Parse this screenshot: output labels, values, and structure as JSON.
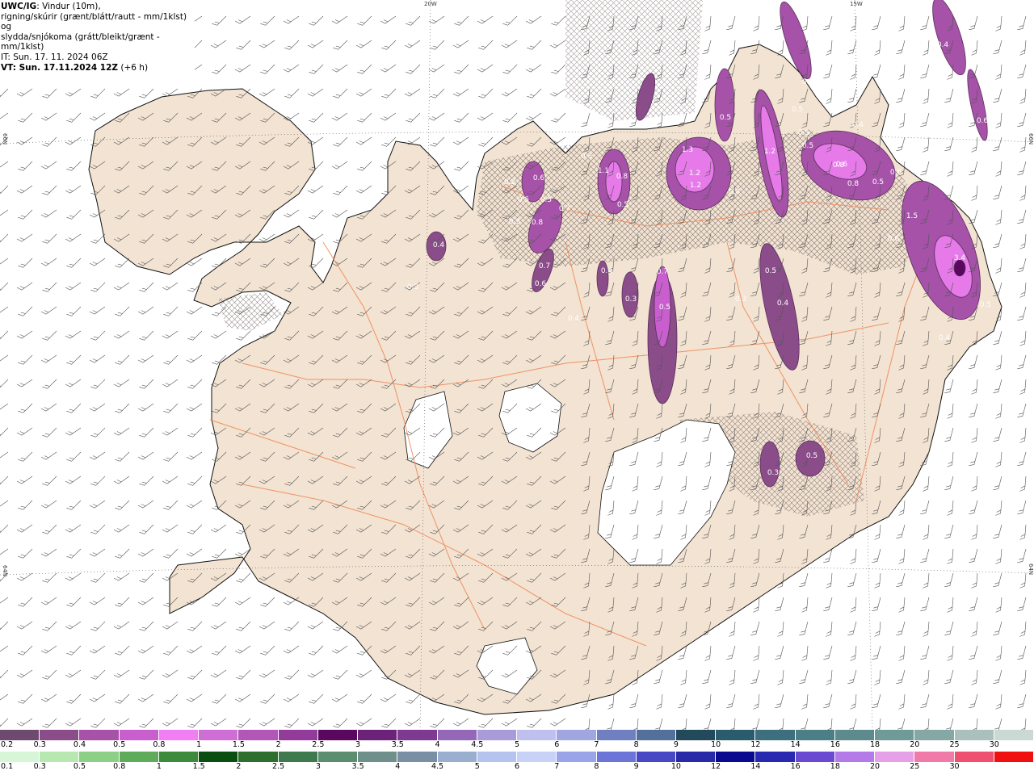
{
  "header": {
    "title_bold": "UWC/IG",
    "title_rest": ": Vindur (10m),",
    "line2": "rigning/skúrir (grænt/blátt/rautt - mm/1klst) og",
    "line3": "slydda/snjókoma (grátt/bleikt/grænt - mm/1klst)",
    "it_line": "IT: Sun. 17. 11. 2024 06Z",
    "vt_line": "VT: Sun. 17.11.2024 12Z",
    "vt_offset": "(+6 h)"
  },
  "grid_labels": {
    "top_20w": "20W",
    "top_15w": "15W",
    "left_66n": "66N",
    "left_64n": "64N",
    "right_66n": "66N",
    "right_64n": "64N"
  },
  "contour_labels": [
    "0.4",
    "0.4",
    "0.4",
    "0.5",
    "0.5",
    "0.5",
    "0.5",
    "0.6",
    "0.6",
    "0.6",
    "0.8",
    "0.8",
    "1.2",
    "1.2",
    "1.2",
    "1.3",
    "0.8",
    "1.1",
    "0.8",
    "0.5",
    "0.2",
    "0.5",
    "0.3",
    "0.6",
    "0.8",
    "0.7",
    "0.5",
    "0.4",
    "0.7",
    "0.6",
    "0.3",
    "0.4",
    "0.3",
    "0.7",
    "0.5",
    "0.3",
    "0.5",
    "0.4",
    "0.3",
    "1.5",
    "0.6",
    "3.4",
    "0.5",
    "0.4",
    "0.3",
    "0.3",
    "0.5",
    "0.1",
    "0.6",
    "0.5"
  ],
  "colors": {
    "land": "#f2e3d2",
    "roads": "#ef8a5a",
    "coast": "#111111",
    "snow_mauve": [
      "#7b4a7c",
      "#a04fa6",
      "#c35bc9",
      "#e57ae8",
      "#f3a8f3"
    ]
  },
  "legend_snow": {
    "labels": [
      "0.2",
      "0.3",
      "0.4",
      "0.5",
      "0.8",
      "1",
      "1.5",
      "2",
      "2.5",
      "3",
      "3.5",
      "4",
      "4.5",
      "5",
      "6",
      "7",
      "8",
      "9",
      "10",
      "12",
      "14",
      "16",
      "18",
      "20",
      "25",
      "30"
    ],
    "colors": [
      "#6f4a6f",
      "#8a4d8a",
      "#a552a8",
      "#c95fcf",
      "#ef7ff2",
      "#cf6fd6",
      "#b256b8",
      "#933b9a",
      "#5a0760",
      "#6b2278",
      "#7e3a90",
      "#9467b8",
      "#a89bd8",
      "#c0c0f0",
      "#9fa6e0",
      "#6f7fc0",
      "#52709a",
      "#234a5a",
      "#2b5c6e",
      "#3e6f7e",
      "#4c7e86",
      "#5d8a8c",
      "#6f9a98",
      "#86a8a4",
      "#a9c0bc",
      "#cbd9d5"
    ]
  },
  "legend_rain": {
    "labels": [
      "0.1",
      "0.3",
      "0.5",
      "0.8",
      "1",
      "1.5",
      "2",
      "2.5",
      "3",
      "3.5",
      "4",
      "4.5",
      "5",
      "6",
      "7",
      "8",
      "9",
      "10",
      "12",
      "14",
      "16",
      "18",
      "20",
      "25",
      "30"
    ],
    "colors": [
      "#d7f6d7",
      "#b7e8b0",
      "#8ccf86",
      "#5eac5a",
      "#3e8a3c",
      "#0a4f10",
      "#2e6e2e",
      "#3e7a4e",
      "#5b8e6e",
      "#6f8f8a",
      "#7a8fa4",
      "#9aaed0",
      "#b4c4ee",
      "#c8d2f6",
      "#9aa4e8",
      "#6c74d8",
      "#4848c4",
      "#2a2aa8",
      "#0a0a90",
      "#2828b0",
      "#6a4ad0",
      "#b47ae8",
      "#e6a0e8",
      "#f07aa8",
      "#f05070",
      "#f01010"
    ]
  }
}
